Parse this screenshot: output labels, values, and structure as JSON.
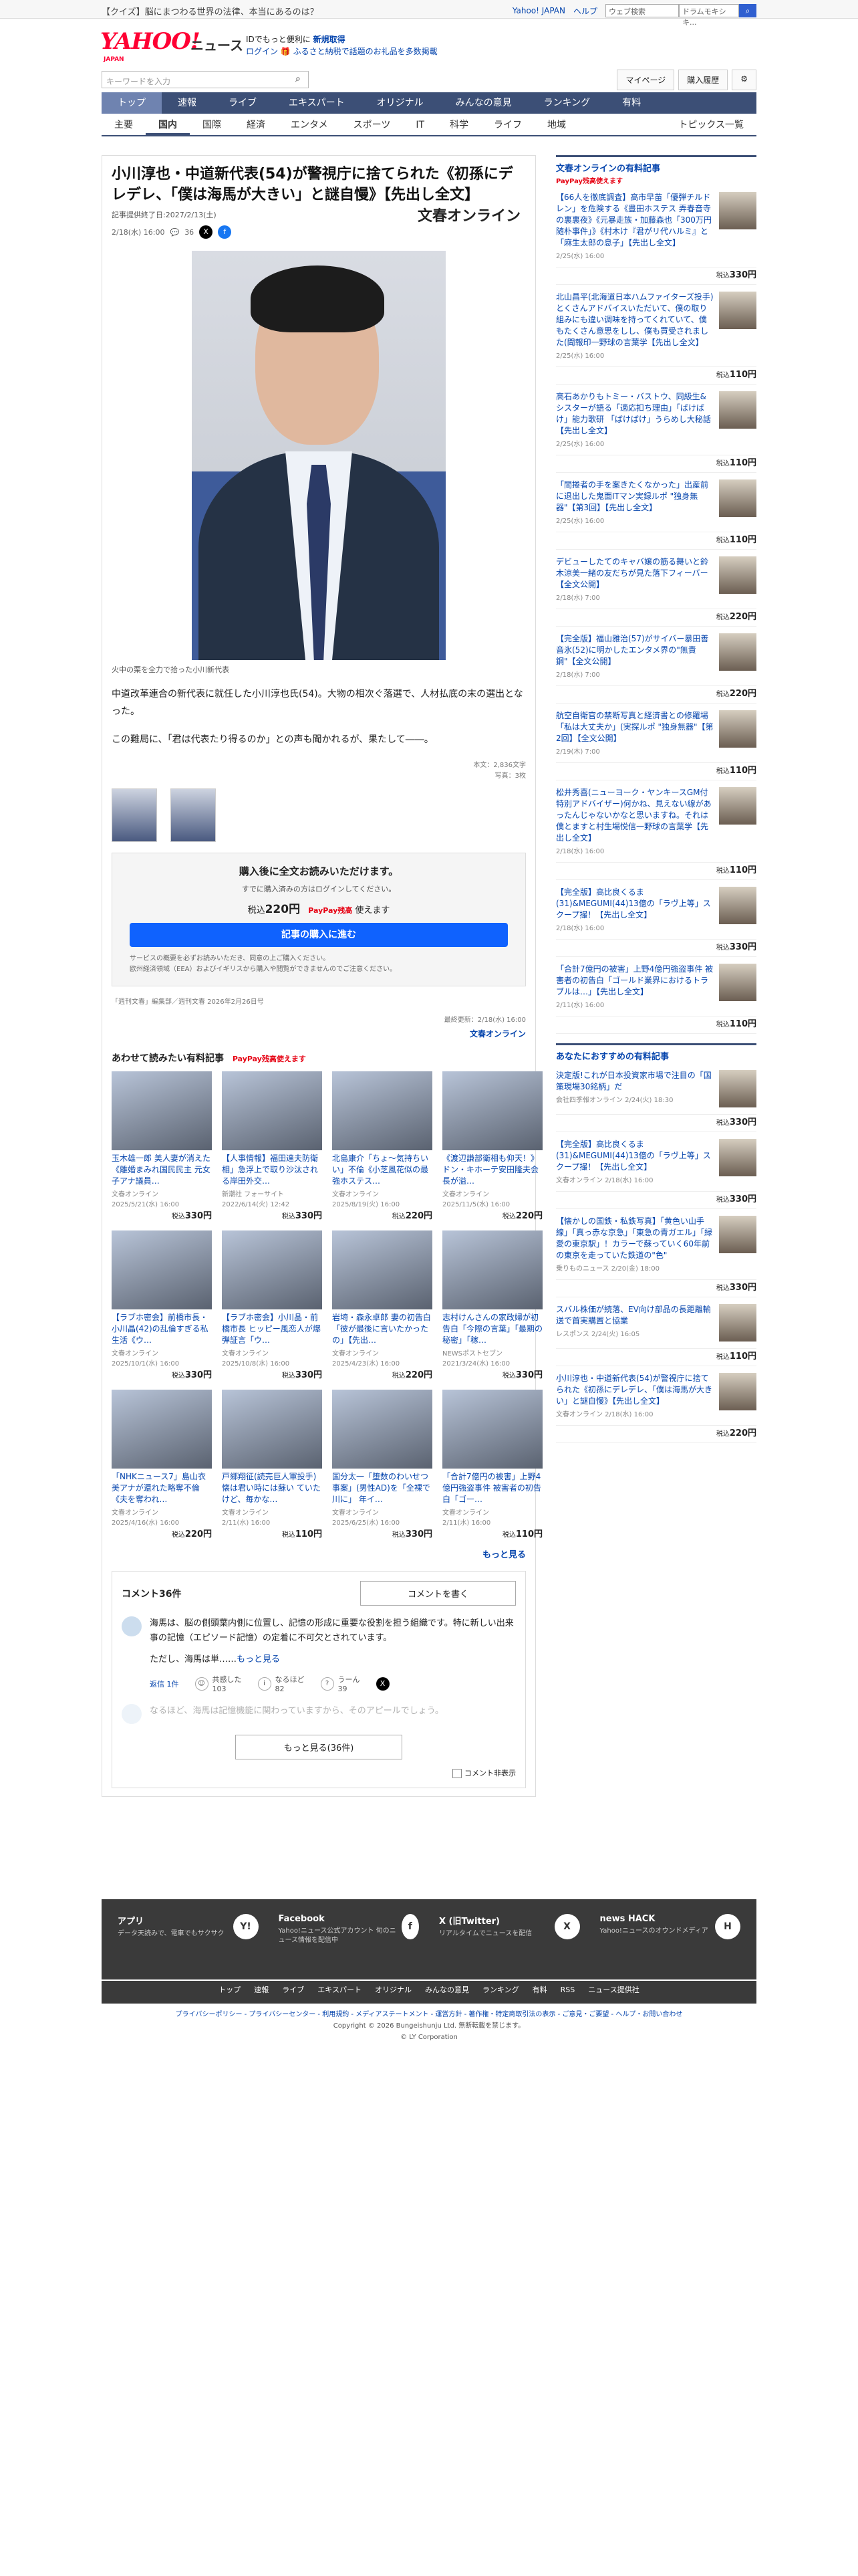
{
  "topbar": {
    "promo": "【クイズ】脳にまつわる世界の法律、本当にあるのは？",
    "links": [
      "Yahoo! JAPAN",
      "ヘルプ"
    ],
    "search_placeholder": "ウェブ検索",
    "search_value": "ドラムモキシキ..."
  },
  "header": {
    "logo": "YAHOO!",
    "logo_sub": "JAPAN",
    "news": "ニュース",
    "promo1": "IDでもっと便利に",
    "promo1_b": "新規取得",
    "promo2": "ログイン",
    "promo2_t": "ふるさと納税で話題のお礼品を多数掲載"
  },
  "search": {
    "placeholder": "キーワードを入力",
    "mypage": "マイページ",
    "buy": "購入履歴"
  },
  "gnav": [
    "トップ",
    "速報",
    "ライブ",
    "エキスパート",
    "オリジナル",
    "みんなの意見",
    "ランキング",
    "有料"
  ],
  "cnav": [
    "主要",
    "国内",
    "国際",
    "経済",
    "エンタメ",
    "スポーツ",
    "IT",
    "科学",
    "ライフ",
    "地域"
  ],
  "cnav_right": "トピックス一覧",
  "article": {
    "title": "小川淳也・中道新代表(54)が警視庁に捨てられた《初孫にデレデレ、「僕は海馬が大きい」と謎自慢》【先出し全文】",
    "meta": "記事提供終了日:2027/2/13(土)",
    "date": "2/18(水) 16:00",
    "count": "36",
    "brand": "文春オンライン",
    "caption": "火中の栗を全力で拾った小川新代表",
    "para1": "中道改革連合の新代表に就任した小川淳也氏(54)。大物の相次ぐ落選で、人材払底の末の選出となった。",
    "para2": "この難局に、「君は代表たり得るのか」との声も聞かれるが、果たして――。",
    "stat1": "本文：2,836文字",
    "stat2": "写真：3枚",
    "buy_title": "購入後に全文お読みいただけます。",
    "buy_sub": "すでに購入済みの方はログインしてください。",
    "price_pre": "税込",
    "price": "220円",
    "paypay": "PayPay残高",
    "paypay_use": "使えます",
    "buy_btn": "記事の購入に進む",
    "note1": "サービスの概要を必ずお読みいただき、同意の上ご購入ください。",
    "note2": "欧州経済領域（EEA）およびイギリスから購入や閲覧ができませんのでご注意ください。",
    "source": "「週刊文春」編集部／週刊文春 2026年2月26日号",
    "updated": "最終更新：2/18(水) 16:00",
    "updated_src": "文春オンライン"
  },
  "paid": {
    "heading": "あわせて読みたい有料記事",
    "pp": "PayPay残高使えます",
    "items": [
      {
        "t": "玉木雄一郎 美人妻が消えた《離婚まみれ国民民主 元女子アナ議員…",
        "s": "文春オンライン",
        "d": "2025/5/21(水) 16:00",
        "p": "330円"
      },
      {
        "t": "【人事情報】福田達夫防衛相」急浮上で取り沙汰される岸田外交…",
        "s": "新潮社 フォーサイト",
        "d": "2022/6/14(火) 12:42",
        "p": "330円"
      },
      {
        "t": "北島康介「ちょ～気持ちいい」不倫《小芝風花似の最強ホステス…",
        "s": "文春オンライン",
        "d": "2025/8/19(火) 16:00",
        "p": "220円"
      },
      {
        "t": "《渡辺謙部衛相も仰天！》ドン・キホーテ安田隆夫会長が溢…",
        "s": "文春オンライン",
        "d": "2025/11/5(水) 16:00",
        "p": "220円"
      },
      {
        "t": "【ラブホ密会】前橋市長・小川晶(42)の乱倫すぎる私生活《ウ…",
        "s": "文春オンライン",
        "d": "2025/10/1(水) 16:00",
        "p": "330円"
      },
      {
        "t": "【ラブホ密会】小川晶・前橋市長 ヒッピー風恋人が爆弾証言「ウ…",
        "s": "文春オンライン",
        "d": "2025/10/8(水) 16:00",
        "p": "330円"
      },
      {
        "t": "岩埼・森永卓郎 妻の初告白「彼が最後に言いたかったの」【先出…",
        "s": "文春オンライン",
        "d": "2025/4/23(水) 16:00",
        "p": "220円"
      },
      {
        "t": "志村けんさんの家政婦が初告白「今際の言葉」「最期の秘密」「稼…",
        "s": "NEWSポストセブン",
        "d": "2021/3/24(水) 16:00",
        "p": "330円"
      },
      {
        "t": "「NHKニュース7」島山衣美アナが還れた略奪不倫《夫を奪われ…",
        "s": "文春オンライン",
        "d": "2025/4/16(水) 16:00",
        "p": "220円"
      },
      {
        "t": "戸郷翔征(読売巨人軍投手)懐は君い時には蘇い ていたけど、毎かな…",
        "s": "文春オンライン",
        "d": "2/11(水) 16:00",
        "p": "110円"
      },
      {
        "t": "国分太一「堕数のわいせつ事案」(男性AD)を「全裸で川に」 年イ…",
        "s": "文春オンライン",
        "d": "2025/6/25(水) 16:00",
        "p": "330円"
      },
      {
        "t": "「合計7億円の被害」上野4億円強盗事件 被害者の初告白「ゴー…",
        "s": "文春オンライン",
        "d": "2/11(水) 16:00",
        "p": "110円"
      }
    ],
    "more": "もっと見る"
  },
  "comments": {
    "count": "コメント36件",
    "write": "コメントを書く",
    "c1": "海馬は、脳の側頭葉内側に位置し、記憶の形成に重要な役割を担う組織です。特に新しい出来事の記憶（エピソード記憶）の定着に不可欠とされています。",
    "c1b": "ただし、海馬は単……",
    "c1more": "もっと見る",
    "reply": "返信 1件",
    "r1": "共感した",
    "r1n": "103",
    "r2": "なるほど",
    "r2n": "82",
    "r3": "うーん",
    "r3n": "39",
    "c2": "なるほど、海馬は記憶機能に関わっていますから、そのアピールでしょう。",
    "more": "もっと見る(36件)",
    "hide": "コメント非表示"
  },
  "side": {
    "h1": "文春オンラインの有料記事",
    "pp": "PayPay残高使えます",
    "items1": [
      {
        "t": "【66人を徹底調査】高市早苗「優弾チルドレン」を危険する《豊田ホステス 弄春音寺の裏裏夜》《元暴走族・加藤森也「300万円随朴事件」》《村木け『君がリ代ハルミ』と「麻生太郎の息子」【先出し全文】",
        "d": "2/25(水) 16:00",
        "p": "330円"
      },
      {
        "t": "北山昌平(北海道日本ハムファイターズ投手)とくさんアドバイスいただいて、僕の取り組みにも違い调味を持ってくれていて、僕もたくさん意思をしし、僕も買受されました(聞報印一野球の言葉学【先出し全文】",
        "d": "2/25(水) 16:00",
        "p": "110円"
      },
      {
        "t": "高石あかりもトミー・バストウ、同級生&シスターが語る「適応扣ち理由」「ばけばけ」能力歌研 「ばけばけ」うらめし大秘話【先出し全文】",
        "d": "2/25(水) 16:00",
        "p": "110円"
      },
      {
        "t": "「間捲者の手を案きたくなかった」出産前に退出した鬼面ITマン実録ルポ \"独身無器\"【第3回】【先出し全文】",
        "d": "2/25(水) 16:00",
        "p": "110円"
      },
      {
        "t": "デビューしたてのキャバ嬢の筋る舞いと鈴木涼美一緒の友だちが見た落下フィーバー【全文公開】",
        "d": "2/18(水) 7:00",
        "p": "220円"
      },
      {
        "t": "【完全版】福山雅治(57)がサイバー暴田善音氷(52)に明かしたエンタメ界の\"無責鋼\"【全文公開】",
        "d": "2/18(水) 7:00",
        "p": "220円"
      },
      {
        "t": "航空自衛官の禁断写真と経済書との修羅場「私は大丈夫か」(実探ルポ \"独身無器\"【第2回】【全文公開】",
        "d": "2/19(木) 7:00",
        "p": "110円"
      },
      {
        "t": "松井秀喜(ニューヨーク・ヤンキースGM付特別アドバイザー)何かね、見えない線があったんじゃないかなと思いますね。それは僕とますと村生場悦信一野球の言葉学【先出し全文】",
        "d": "2/18(水) 16:00",
        "p": "110円"
      },
      {
        "t": "【完全版】高比良くるま(31)&MEGUMI(44)13億の「ラヴ上等」スクープ撮！【先出し全文】",
        "d": "2/18(水) 16:00",
        "p": "330円"
      },
      {
        "t": "「合計7億円の被害」上野4億円強盗事件 被害者の初告白「ゴールド業界におけるトラブルは…」【先出し全文】",
        "d": "2/11(水) 16:00",
        "p": "110円"
      }
    ],
    "h2": "あなたにおすすめの有料記事",
    "items2": [
      {
        "t": "決定版!これが日本投資家市場で注目の「国策現場30銘柄」だ",
        "d": "会社四季報オンライン 2/24(火) 18:30",
        "p": "330円"
      },
      {
        "t": "【完全版】高比良くるま(31)&MEGUMI(44)13億の「ラヴ上等」スクープ撮！【先出し全文】",
        "d": "文春オンライン 2/18(水) 16:00",
        "p": "330円"
      },
      {
        "t": "【懐かしの国鉄・私鉄写真】「黄色い山手線」「真っ赤な京急」「東急の青ガエル」「緑愛の東京駅」！カラーで蘇っていく60年前の東京を走っていた鉄道の\"色\"",
        "d": "乗りものニュース 2/20(金) 18:00",
        "p": "330円"
      },
      {
        "t": "スバル株価が続落、EV向け部品の長距離輸送で首実購置と協業",
        "d": "レスポンス 2/24(火) 16:05",
        "p": "110円"
      },
      {
        "t": "小川淳也・中道新代表(54)が警視庁に捨てられた《初孫にデレデレ、「僕は海馬が大きい」と謎自慢》【先出し全文】",
        "d": "文春オンライン 2/18(水) 16:00",
        "p": "220円"
      }
    ]
  },
  "footer": {
    "cols": [
      {
        "h": "アプリ",
        "p": "データ天読みで、電車でもサクサク",
        "icon": "Y!"
      },
      {
        "h": "Facebook",
        "p": "Yahoo!ニュース公式アカウント 旬のニュース情報を配信中",
        "icon": "f"
      },
      {
        "h": "X (旧Twitter)",
        "p": "リアルタイムでニュースを配信",
        "icon": "X"
      },
      {
        "h": "news HACK",
        "p": "Yahoo!ニュースのオウンドメディア",
        "icon": "H"
      }
    ],
    "nav": [
      "トップ",
      "速報",
      "ライブ",
      "エキスパート",
      "オリジナル",
      "みんなの意見",
      "ランキング",
      "有料",
      "RSS",
      "ニュース提供社"
    ],
    "legal": "プライバシーポリシー - プライバシーセンター - 利用規約 - メディアステートメント - 運営方針 - 著作権・特定商取引法の表示 - ご意見・ご要望 - ヘルプ・お問い合わせ",
    "copy1": "Copyright © 2026 Bungeishunju Ltd. 無断転載を禁じます。",
    "copy2": "© LY Corporation"
  }
}
